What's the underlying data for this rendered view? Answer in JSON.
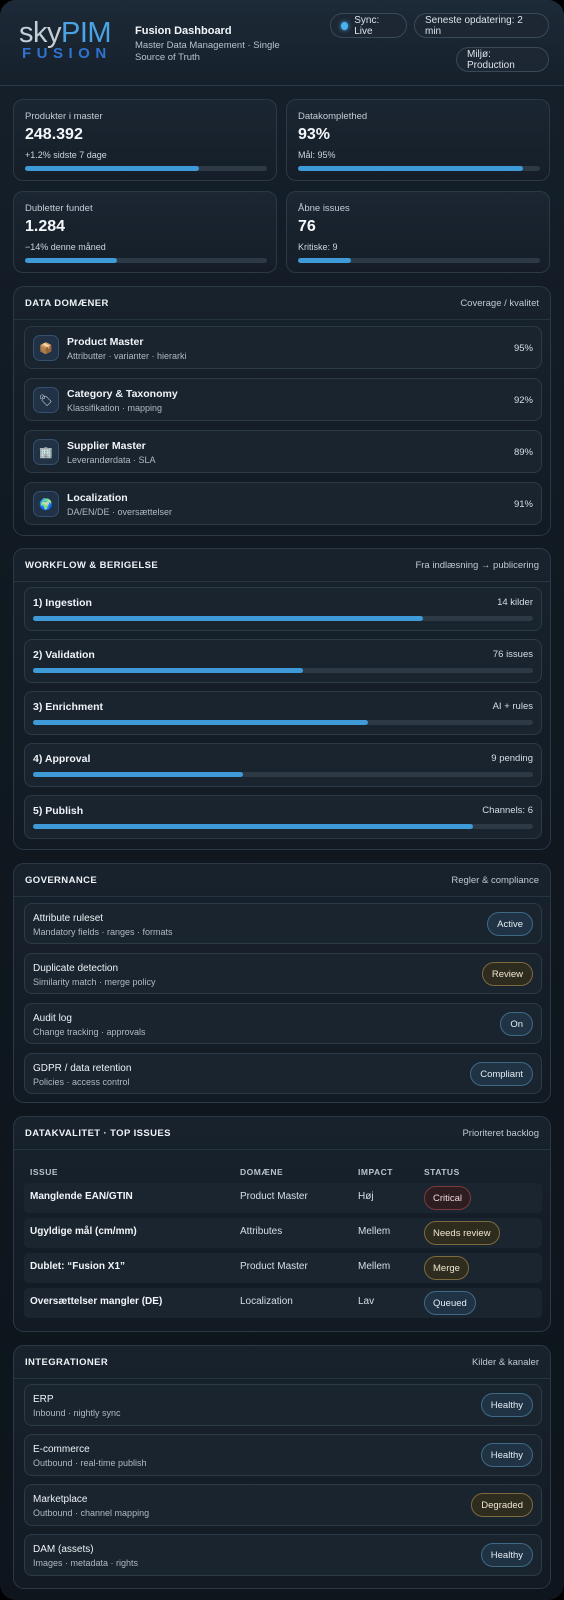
{
  "header": {
    "logo_sky": "sky",
    "logo_pim": "PIM",
    "logo_fusion": "FUSION",
    "title": "Fusion Dashboard",
    "subtitle": "Master Data Management · Single Source of Truth",
    "sync": "Sync: Live",
    "updated": "Seneste opdatering: 2 min",
    "env": "Miljø: Production"
  },
  "kpis": [
    {
      "label": "Produkter i master",
      "value": "248.392",
      "sub": "+1.2% sidste 7 dage",
      "progress": 0.72
    },
    {
      "label": "Datakomplethed",
      "value": "93%",
      "sub": "Mål: 95%",
      "progress": 0.93
    },
    {
      "label": "Dubletter fundet",
      "value": "1.284",
      "sub": "−14% denne måned",
      "progress": 0.38
    },
    {
      "label": "Åbne issues",
      "value": "76",
      "sub": "Kritiske: 9",
      "progress": 0.22
    }
  ],
  "domains": {
    "title": "DATA DOMÆNER",
    "right": "Coverage / kvalitet",
    "items": [
      {
        "name": "Product Master",
        "sub": "Attributter · varianter · hierarki",
        "value": "95%",
        "icon": "box-icon"
      },
      {
        "name": "Category & Taxonomy",
        "sub": "Klassifikation · mapping",
        "value": "92%",
        "icon": "tag-icon"
      },
      {
        "name": "Supplier Master",
        "sub": "Leverandørdata · SLA",
        "value": "89%",
        "icon": "building-icon"
      },
      {
        "name": "Localization",
        "sub": "DA/EN/DE · oversættelser",
        "value": "91%",
        "icon": "globe-icon"
      }
    ]
  },
  "workflow": {
    "title": "WORKFLOW & BERIGELSE",
    "right": "Fra indlæsning → publicering",
    "steps": [
      {
        "name": "1) Ingestion",
        "right": "14 kilder",
        "progress": 0.78
      },
      {
        "name": "2) Validation",
        "right": "76 issues",
        "progress": 0.54
      },
      {
        "name": "3) Enrichment",
        "right": "AI + rules",
        "progress": 0.67
      },
      {
        "name": "4) Approval",
        "right": "9 pending",
        "progress": 0.42
      },
      {
        "name": "5) Publish",
        "right": "Channels: 6",
        "progress": 0.88
      }
    ]
  },
  "governance": {
    "title": "GOVERNANCE",
    "right": "Regler & compliance",
    "items": [
      {
        "name": "Attribute ruleset",
        "sub": "Mandatory fields · ranges · formats",
        "badge": "Active",
        "tone": "ok"
      },
      {
        "name": "Duplicate detection",
        "sub": "Similarity match · merge policy",
        "badge": "Review",
        "tone": "warn"
      },
      {
        "name": "Audit log",
        "sub": "Change tracking · approvals",
        "badge": "On",
        "tone": "ok"
      },
      {
        "name": "GDPR / data retention",
        "sub": "Policies · access control",
        "badge": "Compliant",
        "tone": "ok"
      }
    ]
  },
  "issues": {
    "title": "DATAKVALITET · TOP ISSUES",
    "right": "Prioriteret backlog",
    "headers": [
      "ISSUE",
      "DOMÆNE",
      "IMPACT",
      "STATUS"
    ],
    "rows": [
      {
        "issue": "Manglende EAN/GTIN",
        "domain": "Product Master",
        "impact": "Høj",
        "status": "Critical",
        "tone": "crit"
      },
      {
        "issue": "Ugyldige mål (cm/mm)",
        "domain": "Attributes",
        "impact": "Mellem",
        "status": "Needs review",
        "tone": "warn"
      },
      {
        "issue": "Dublet: “Fusion X1”",
        "domain": "Product Master",
        "impact": "Mellem",
        "status": "Merge",
        "tone": "warn"
      },
      {
        "issue": "Oversættelser mangler (DE)",
        "domain": "Localization",
        "impact": "Lav",
        "status": "Queued",
        "tone": "ok"
      }
    ]
  },
  "integrations": {
    "title": "INTEGRATIONER",
    "right": "Kilder & kanaler",
    "items": [
      {
        "name": "ERP",
        "sub": "Inbound · nightly sync",
        "badge": "Healthy",
        "tone": "ok"
      },
      {
        "name": "E-commerce",
        "sub": "Outbound · real-time publish",
        "badge": "Healthy",
        "tone": "ok"
      },
      {
        "name": "Marketplace",
        "sub": "Outbound · channel mapping",
        "badge": "Degraded",
        "tone": "warn"
      },
      {
        "name": "DAM (assets)",
        "sub": "Images · metadata · rights",
        "badge": "Healthy",
        "tone": "ok"
      }
    ]
  }
}
